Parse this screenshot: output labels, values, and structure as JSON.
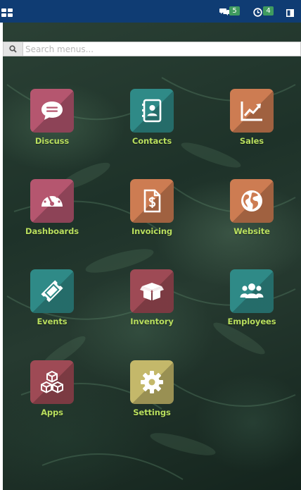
{
  "topbar": {
    "chat_count": "5",
    "activity_count": "4",
    "icons": [
      "apps-grid-icon",
      "chat-icon",
      "clock-icon",
      "panel-toggle-icon"
    ]
  },
  "search": {
    "placeholder": "Search menus...",
    "icon": "search-icon"
  },
  "apps": [
    {
      "label": "Discuss",
      "icon": "chat-bubble-icon",
      "color": "#b5566f"
    },
    {
      "label": "Contacts",
      "icon": "address-book-icon",
      "color": "#2f8a87"
    },
    {
      "label": "Sales",
      "icon": "trend-chart-icon",
      "color": "#cd7c52"
    },
    {
      "label": "Dashboards",
      "icon": "gauge-icon",
      "color": "#b5566f"
    },
    {
      "label": "Invoicing",
      "icon": "invoice-dollar-icon",
      "color": "#cd7c52"
    },
    {
      "label": "Website",
      "icon": "globe-icon",
      "color": "#cd7c52"
    },
    {
      "label": "Events",
      "icon": "ticket-icon",
      "color": "#2f8a87"
    },
    {
      "label": "Inventory",
      "icon": "box-icon",
      "color": "#9e4a55"
    },
    {
      "label": "Employees",
      "icon": "users-icon",
      "color": "#2f8a87"
    },
    {
      "label": "Apps",
      "icon": "cubes-icon",
      "color": "#9e4a55"
    },
    {
      "label": "Settings",
      "icon": "gear-icon",
      "color": "#c4b86a"
    }
  ]
}
